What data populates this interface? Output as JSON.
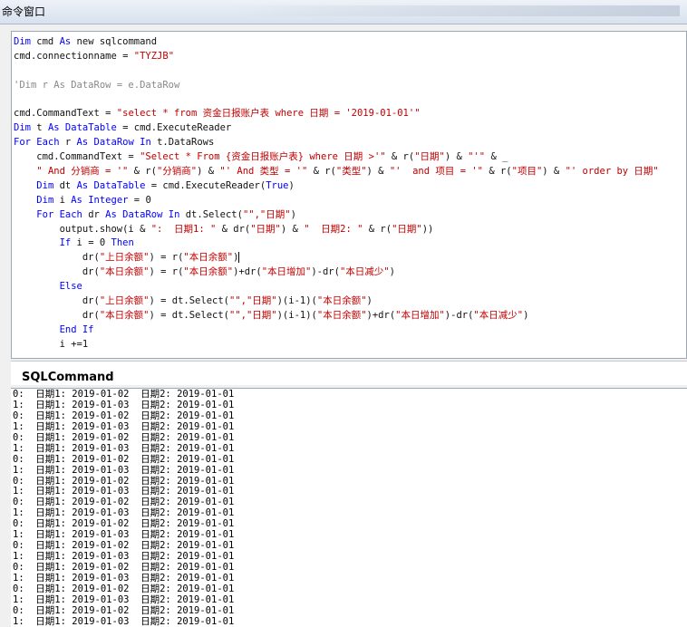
{
  "window": {
    "title": "命令窗口"
  },
  "editor": {
    "lines": [
      [
        {
          "t": "Dim",
          "c": "kw"
        },
        {
          "t": " cmd ",
          "c": ""
        },
        {
          "t": "As",
          "c": "kw"
        },
        {
          "t": " new sqlcommand",
          "c": ""
        }
      ],
      [
        {
          "t": "cmd.connectionname = ",
          "c": ""
        },
        {
          "t": "\"TYZJB\"",
          "c": "str"
        }
      ],
      [],
      [
        {
          "t": "'Dim r As DataRow = e.DataRow",
          "c": "cm"
        }
      ],
      [],
      [
        {
          "t": "cmd.CommandText = ",
          "c": ""
        },
        {
          "t": "\"select * from 资金日报账户表 where 日期 = '2019-01-01'\"",
          "c": "str"
        }
      ],
      [
        {
          "t": "Dim",
          "c": "kw"
        },
        {
          "t": " t ",
          "c": ""
        },
        {
          "t": "As",
          "c": "kw"
        },
        {
          "t": " ",
          "c": ""
        },
        {
          "t": "DataTable",
          "c": "kw"
        },
        {
          "t": " = cmd.ExecuteReader",
          "c": ""
        }
      ],
      [
        {
          "t": "For Each",
          "c": "kw"
        },
        {
          "t": " r ",
          "c": ""
        },
        {
          "t": "As",
          "c": "kw"
        },
        {
          "t": " ",
          "c": ""
        },
        {
          "t": "DataRow",
          "c": "kw"
        },
        {
          "t": " ",
          "c": ""
        },
        {
          "t": "In",
          "c": "kw"
        },
        {
          "t": " t.DataRows",
          "c": ""
        }
      ],
      [
        {
          "t": "    cmd.CommandText = ",
          "c": ""
        },
        {
          "t": "\"Select * From {资金日报账户表} where 日期 >'\"",
          "c": "str"
        },
        {
          "t": " & r(",
          "c": ""
        },
        {
          "t": "\"日期\"",
          "c": "str"
        },
        {
          "t": ") & ",
          "c": ""
        },
        {
          "t": "\"'\"",
          "c": "str"
        },
        {
          "t": " & _",
          "c": ""
        }
      ],
      [
        {
          "t": "    ",
          "c": ""
        },
        {
          "t": "\" And 分销商 = '\"",
          "c": "str"
        },
        {
          "t": " & r(",
          "c": ""
        },
        {
          "t": "\"分销商\"",
          "c": "str"
        },
        {
          "t": ") & ",
          "c": ""
        },
        {
          "t": "\"' And 类型 = '\"",
          "c": "str"
        },
        {
          "t": " & r(",
          "c": ""
        },
        {
          "t": "\"类型\"",
          "c": "str"
        },
        {
          "t": ") & ",
          "c": ""
        },
        {
          "t": "\"'  and 项目 = '\"",
          "c": "str"
        },
        {
          "t": " & r(",
          "c": ""
        },
        {
          "t": "\"项目\"",
          "c": "str"
        },
        {
          "t": ") & ",
          "c": ""
        },
        {
          "t": "\"' order by 日期\"",
          "c": "str"
        }
      ],
      [
        {
          "t": "    ",
          "c": ""
        },
        {
          "t": "Dim",
          "c": "kw"
        },
        {
          "t": " dt ",
          "c": ""
        },
        {
          "t": "As",
          "c": "kw"
        },
        {
          "t": " ",
          "c": ""
        },
        {
          "t": "DataTable",
          "c": "kw"
        },
        {
          "t": " = cmd.ExecuteReader(",
          "c": ""
        },
        {
          "t": "True",
          "c": "kw"
        },
        {
          "t": ")",
          "c": ""
        }
      ],
      [
        {
          "t": "    ",
          "c": ""
        },
        {
          "t": "Dim",
          "c": "kw"
        },
        {
          "t": " i ",
          "c": ""
        },
        {
          "t": "As",
          "c": "kw"
        },
        {
          "t": " ",
          "c": ""
        },
        {
          "t": "Integer",
          "c": "kw"
        },
        {
          "t": " = 0",
          "c": ""
        }
      ],
      [
        {
          "t": "    ",
          "c": ""
        },
        {
          "t": "For Each",
          "c": "kw"
        },
        {
          "t": " dr ",
          "c": ""
        },
        {
          "t": "As",
          "c": "kw"
        },
        {
          "t": " ",
          "c": ""
        },
        {
          "t": "DataRow",
          "c": "kw"
        },
        {
          "t": " ",
          "c": ""
        },
        {
          "t": "In",
          "c": "kw"
        },
        {
          "t": " dt.Select(",
          "c": ""
        },
        {
          "t": "\"\",\"日期\"",
          "c": "str"
        },
        {
          "t": ")",
          "c": ""
        }
      ],
      [
        {
          "t": "        output.show(i & ",
          "c": ""
        },
        {
          "t": "\":  日期1: \"",
          "c": "str"
        },
        {
          "t": " & dr(",
          "c": ""
        },
        {
          "t": "\"日期\"",
          "c": "str"
        },
        {
          "t": ") & ",
          "c": ""
        },
        {
          "t": "\"  日期2: \"",
          "c": "str"
        },
        {
          "t": " & r(",
          "c": ""
        },
        {
          "t": "\"日期\"",
          "c": "str"
        },
        {
          "t": "))",
          "c": ""
        }
      ],
      [
        {
          "t": "        ",
          "c": ""
        },
        {
          "t": "If",
          "c": "kw"
        },
        {
          "t": " i = 0 ",
          "c": ""
        },
        {
          "t": "Then",
          "c": "kw"
        }
      ],
      [
        {
          "t": "            dr(",
          "c": ""
        },
        {
          "t": "\"上日余额\"",
          "c": "str"
        },
        {
          "t": ") = r(",
          "c": ""
        },
        {
          "t": "\"本日余额\"",
          "c": "str"
        },
        {
          "t": ")",
          "c": ""
        },
        {
          "t": "",
          "c": "cur"
        }
      ],
      [
        {
          "t": "            dr(",
          "c": ""
        },
        {
          "t": "\"本日余额\"",
          "c": "str"
        },
        {
          "t": ") = r(",
          "c": ""
        },
        {
          "t": "\"本日余额\"",
          "c": "str"
        },
        {
          "t": ")+dr(",
          "c": ""
        },
        {
          "t": "\"本日增加\"",
          "c": "str"
        },
        {
          "t": ")-dr(",
          "c": ""
        },
        {
          "t": "\"本日减少\"",
          "c": "str"
        },
        {
          "t": ")",
          "c": ""
        }
      ],
      [
        {
          "t": "        ",
          "c": ""
        },
        {
          "t": "Else",
          "c": "kw"
        }
      ],
      [
        {
          "t": "            dr(",
          "c": ""
        },
        {
          "t": "\"上日余额\"",
          "c": "str"
        },
        {
          "t": ") = dt.Select(",
          "c": ""
        },
        {
          "t": "\"\",\"日期\"",
          "c": "str"
        },
        {
          "t": ")(i-1)(",
          "c": ""
        },
        {
          "t": "\"本日余额\"",
          "c": "str"
        },
        {
          "t": ")",
          "c": ""
        }
      ],
      [
        {
          "t": "            dr(",
          "c": ""
        },
        {
          "t": "\"本日余额\"",
          "c": "str"
        },
        {
          "t": ") = dt.Select(",
          "c": ""
        },
        {
          "t": "\"\",\"日期\"",
          "c": "str"
        },
        {
          "t": ")(i-1)(",
          "c": ""
        },
        {
          "t": "\"本日余额\"",
          "c": "str"
        },
        {
          "t": ")+dr(",
          "c": ""
        },
        {
          "t": "\"本日增加\"",
          "c": "str"
        },
        {
          "t": ")-dr(",
          "c": ""
        },
        {
          "t": "\"本日减少\"",
          "c": "str"
        },
        {
          "t": ")",
          "c": ""
        }
      ],
      [
        {
          "t": "        ",
          "c": ""
        },
        {
          "t": "End If",
          "c": "kw"
        }
      ],
      [
        {
          "t": "        i +=1",
          "c": ""
        }
      ]
    ]
  },
  "separator": {
    "label": "SQLCommand"
  },
  "output": {
    "lines": [
      "0:  日期1: 2019-01-02  日期2: 2019-01-01",
      "1:  日期1: 2019-01-03  日期2: 2019-01-01",
      "0:  日期1: 2019-01-02  日期2: 2019-01-01",
      "1:  日期1: 2019-01-03  日期2: 2019-01-01",
      "0:  日期1: 2019-01-02  日期2: 2019-01-01",
      "1:  日期1: 2019-01-03  日期2: 2019-01-01",
      "0:  日期1: 2019-01-02  日期2: 2019-01-01",
      "1:  日期1: 2019-01-03  日期2: 2019-01-01",
      "0:  日期1: 2019-01-02  日期2: 2019-01-01",
      "1:  日期1: 2019-01-03  日期2: 2019-01-01",
      "0:  日期1: 2019-01-02  日期2: 2019-01-01",
      "1:  日期1: 2019-01-03  日期2: 2019-01-01",
      "0:  日期1: 2019-01-02  日期2: 2019-01-01",
      "1:  日期1: 2019-01-03  日期2: 2019-01-01",
      "0:  日期1: 2019-01-02  日期2: 2019-01-01",
      "1:  日期1: 2019-01-03  日期2: 2019-01-01",
      "0:  日期1: 2019-01-02  日期2: 2019-01-01",
      "1:  日期1: 2019-01-03  日期2: 2019-01-01",
      "0:  日期1: 2019-01-02  日期2: 2019-01-01",
      "1:  日期1: 2019-01-03  日期2: 2019-01-01",
      "0:  日期1: 2019-01-02  日期2: 2019-01-01",
      "1:  日期1: 2019-01-03  日期2: 2019-01-01"
    ]
  },
  "colors": {
    "keyword": "#0000ff",
    "string": "#c00000",
    "comment": "#888888"
  }
}
